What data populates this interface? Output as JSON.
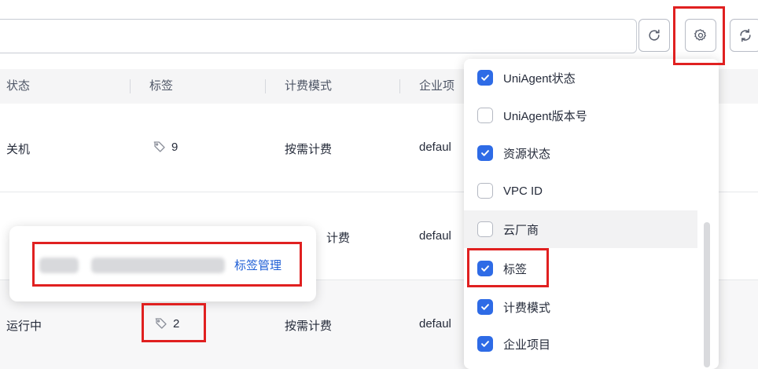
{
  "toolbar": {
    "search_value": "",
    "refresh_icon": "refresh-icon",
    "settings_icon": "gear-icon",
    "sync_icon": "sync-icon"
  },
  "table": {
    "headers": [
      "状态",
      "标签",
      "计费模式",
      "企业项"
    ],
    "rows": [
      {
        "status": "关机",
        "tag_count": "9",
        "billing": "按需计费",
        "project": "defaul"
      },
      {
        "status": "",
        "tag_count": "",
        "billing": "计费",
        "project": "defaul"
      },
      {
        "status": "运行中",
        "tag_count": "2",
        "billing": "按需计费",
        "project": "defaul"
      }
    ]
  },
  "tag_popover": {
    "manage_link": "标签管理"
  },
  "column_settings": {
    "options": [
      {
        "label": "UniAgent状态",
        "checked": true
      },
      {
        "label": "UniAgent版本号",
        "checked": false
      },
      {
        "label": "资源状态",
        "checked": true
      },
      {
        "label": "VPC ID",
        "checked": false
      },
      {
        "label": "云厂商",
        "checked": false
      },
      {
        "label": "标签",
        "checked": true
      },
      {
        "label": "计费模式",
        "checked": true
      },
      {
        "label": "企业项目",
        "checked": true
      }
    ]
  },
  "colors": {
    "accent": "#2e6be6",
    "link": "#1f5fd6",
    "highlight": "#e02020",
    "header_bg": "#f5f5f6"
  }
}
